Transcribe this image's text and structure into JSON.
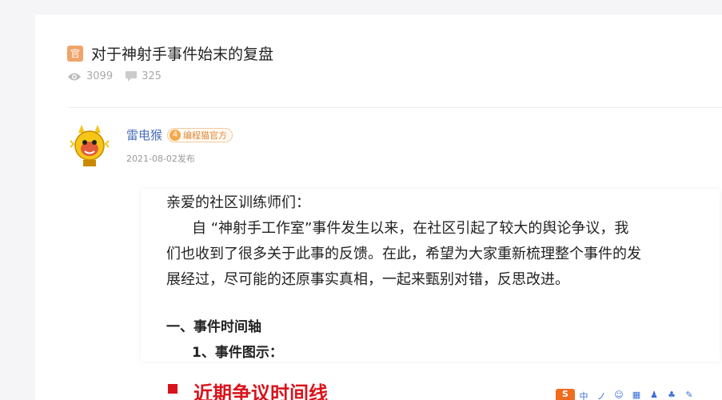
{
  "post": {
    "badge": "官",
    "title": "对于神射手事件始末的复盘",
    "views": "3099",
    "comments": "325"
  },
  "author": {
    "name": "雷电猴",
    "level": "4",
    "tag": "编程猫官方",
    "date": "2021-08-02发布"
  },
  "content": {
    "greeting": "亲爱的社区训练师们：",
    "paragraph": [
      "自 “神射手工作室”事件发生以来，在社区引起了较大的舆论争议，我",
      "们也收到了很多关于此事的反馈。在此，希望为大家重新梳理整个事件的发",
      "展经过，尽可能的还原事实真相，一起来甄别对错，反思改进。"
    ],
    "section1": "一、事件时间轴",
    "section1_1": "1、事件图示：",
    "image_heading": "近期争议时间线"
  },
  "toolbar": {
    "items": [
      "S",
      "中",
      "ノ",
      "☺",
      "▦",
      "♟",
      "♣",
      "✎"
    ]
  },
  "colors": {
    "accent_red": "#d9131b",
    "link_blue": "#4a6fb8",
    "badge_orange": "#f0a36b"
  }
}
